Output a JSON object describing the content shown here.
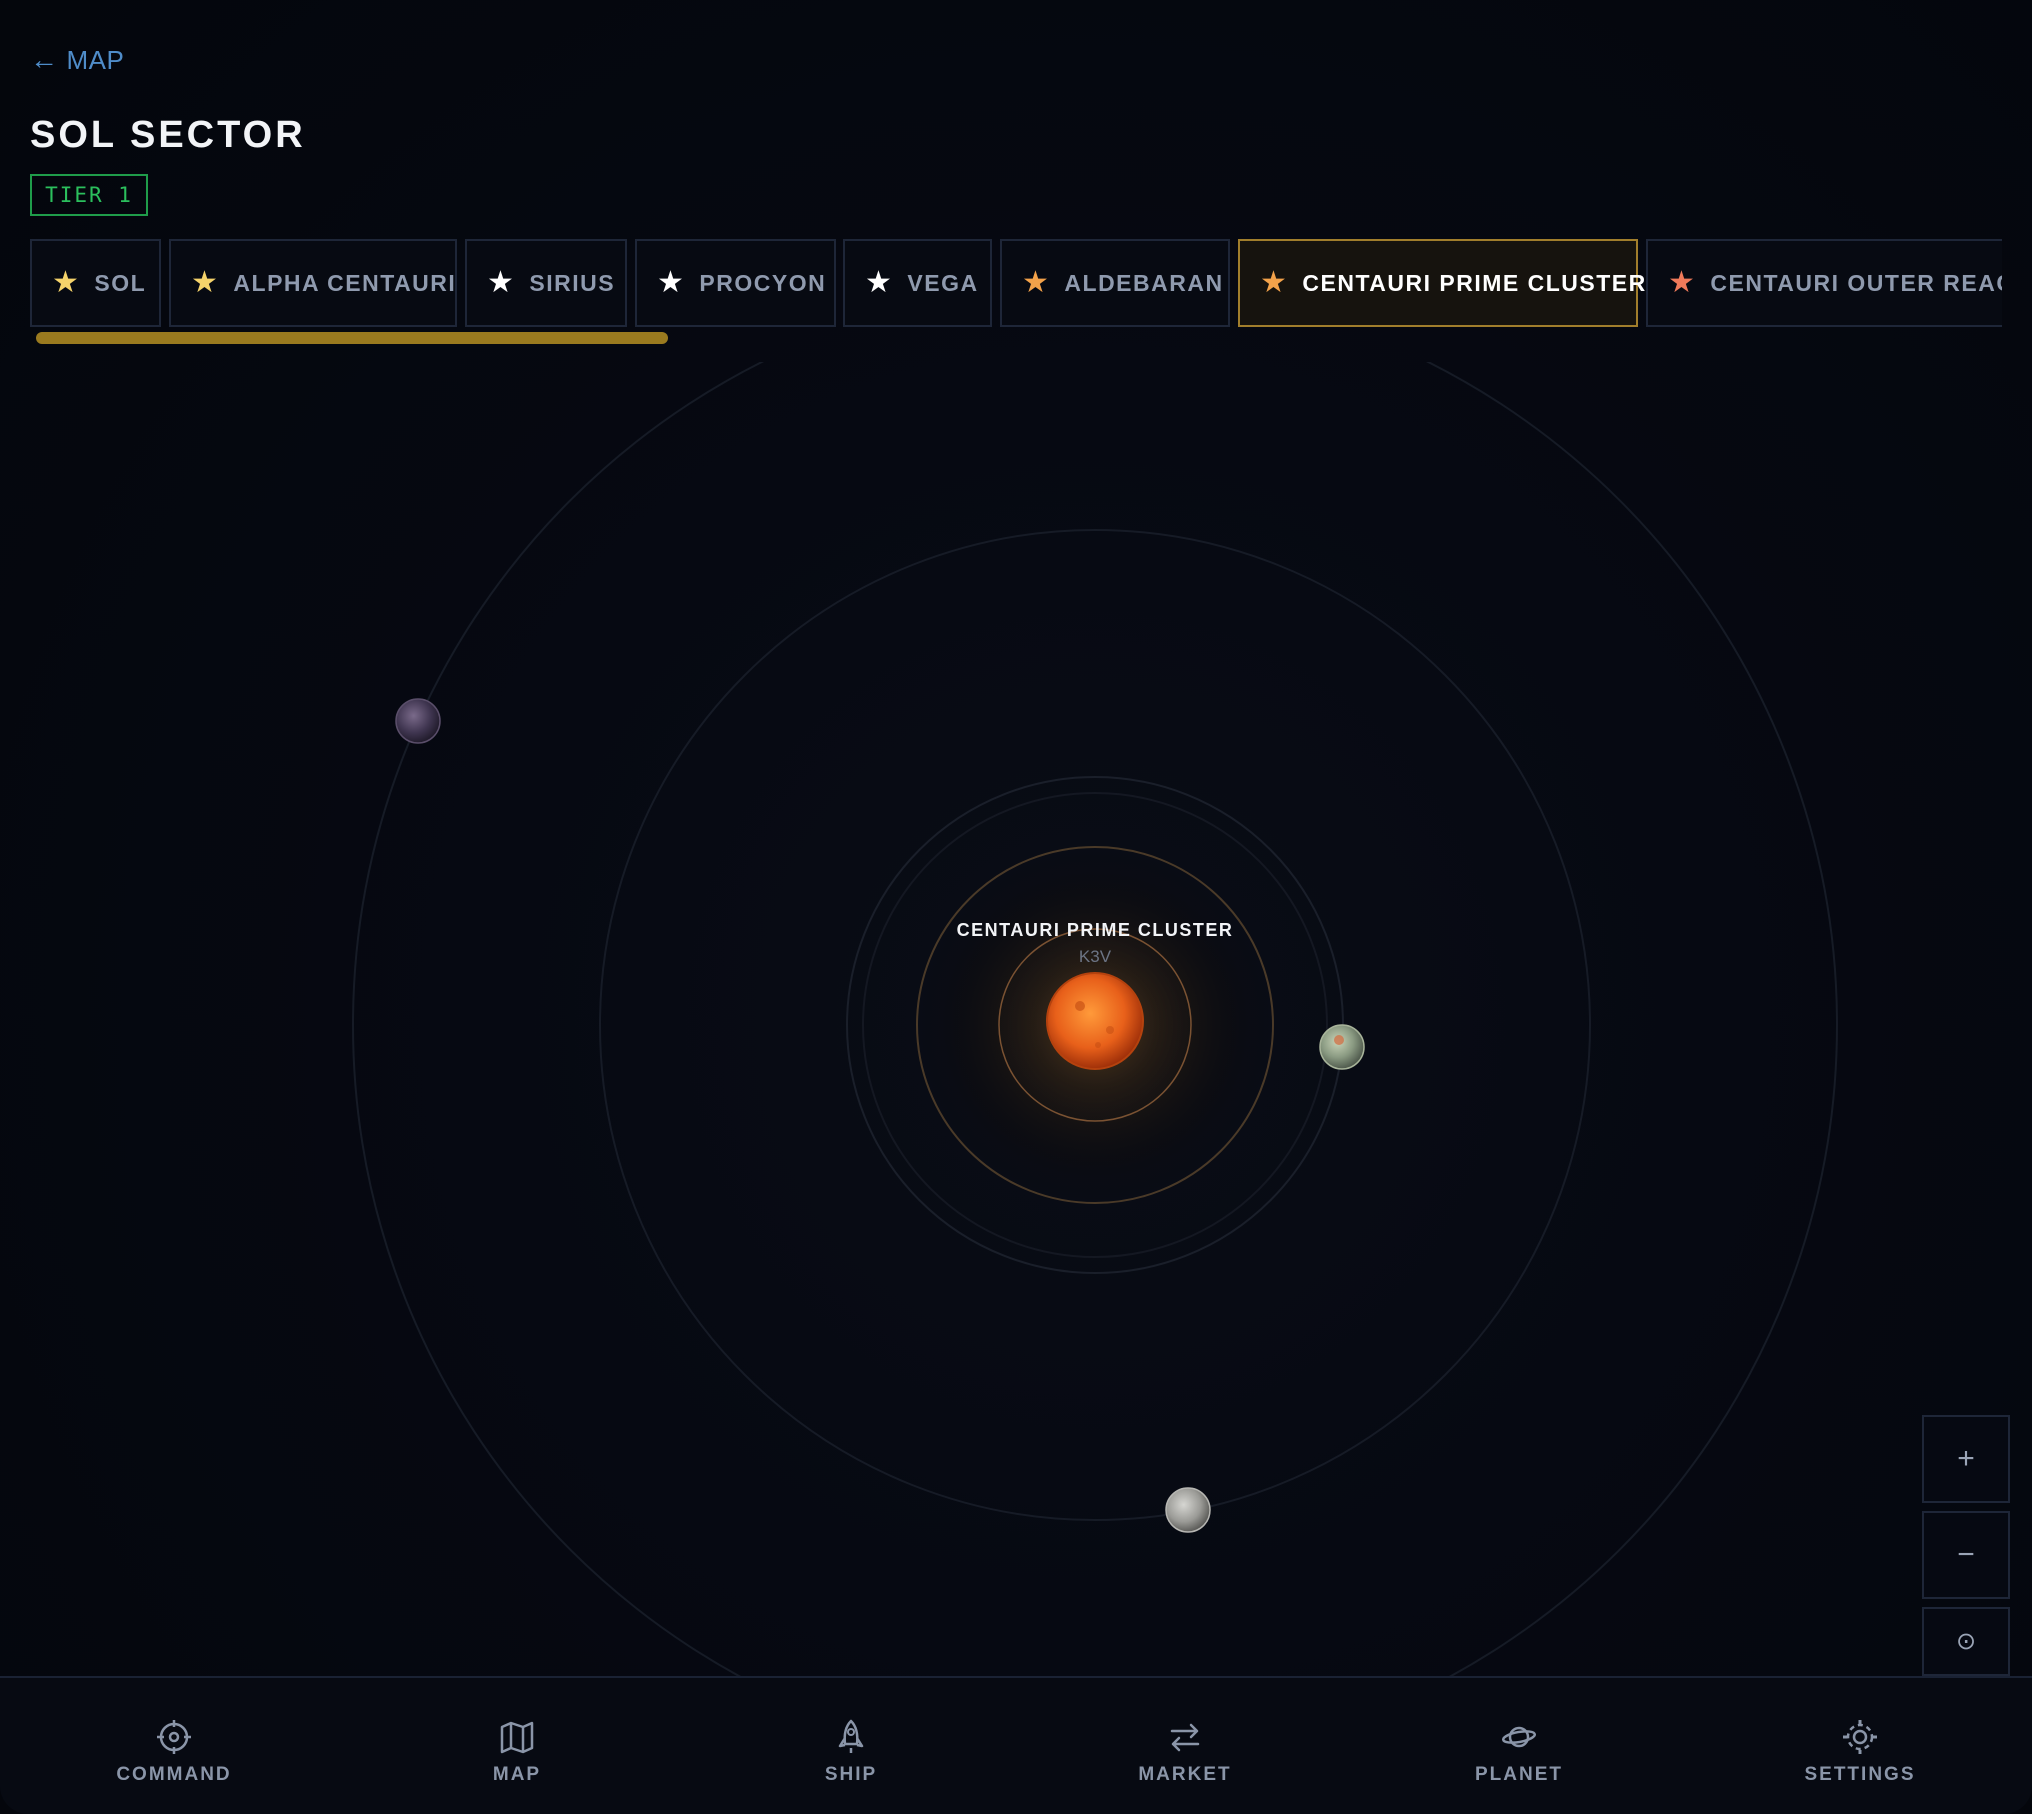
{
  "header": {
    "back_arrow": "←",
    "back_label": "MAP",
    "sector_title": "SOL SECTOR",
    "tier_label": "TIER 1"
  },
  "tabs": [
    {
      "label": "SOL",
      "star": "★",
      "star_color": "#f5d36b",
      "active": false
    },
    {
      "label": "ALPHA CENTAURI",
      "star": "★",
      "star_color": "#f5d36b",
      "active": false
    },
    {
      "label": "SIRIUS",
      "star": "★",
      "star_color": "#ffffff",
      "active": false
    },
    {
      "label": "PROCYON",
      "star": "★",
      "star_color": "#ffffff",
      "active": false
    },
    {
      "label": "VEGA",
      "star": "★",
      "star_color": "#ffffff",
      "active": false
    },
    {
      "label": "ALDEBARAN",
      "star": "★",
      "star_color": "#f3a24a",
      "active": false
    },
    {
      "label": "CENTAURI PRIME CLUSTER",
      "star": "★",
      "star_color": "#f3a24a",
      "active": true
    },
    {
      "label": "CENTAURI OUTER REACH",
      "star": "★",
      "star_color": "#f07a5a",
      "active": false
    }
  ],
  "system": {
    "star_name": "CENTAURI PRIME CLUSTER",
    "star_class": "K3V"
  },
  "zoom_controls": {
    "zoom_in": "+",
    "zoom_out": "−",
    "recenter": "⊙"
  },
  "nav": {
    "items": [
      {
        "label": "COMMAND",
        "icon": "crosshair-icon"
      },
      {
        "label": "MAP",
        "icon": "map-icon"
      },
      {
        "label": "SHIP",
        "icon": "rocket-icon"
      },
      {
        "label": "MARKET",
        "icon": "exchange-icon"
      },
      {
        "label": "PLANET",
        "icon": "planet-icon"
      },
      {
        "label": "SETTINGS",
        "icon": "gear-icon"
      }
    ]
  },
  "colors": {
    "accent_gold": "#a17e2c",
    "tier_green": "#2bbf5d",
    "link_blue": "#4f8cc9",
    "star_orange": "#e8601a"
  }
}
